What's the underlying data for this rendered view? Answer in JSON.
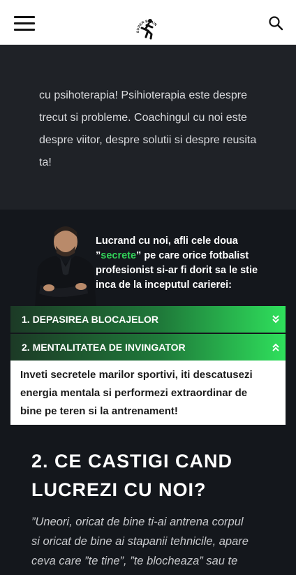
{
  "header": {
    "menu_icon": "hamburger-menu-icon",
    "logo_text": "SUPER BRAIN",
    "search_icon": "search-icon"
  },
  "intro": {
    "lines": [
      "cu psihoterapia! Psihioterapia este despre",
      "trecut si probleme. Coachingul cu noi este",
      "despre viitor, despre solutii si despre reusita",
      "ta!"
    ]
  },
  "secrets": {
    "line1": "Lucrand cu noi, afli cele doua",
    "line2_open": "”",
    "line2_accent": "secrete",
    "line2_rest": "” pe care orice fotbalist",
    "line3": "profesionist si-ar fi dorit sa le stie",
    "line4": "inca de la inceputul carierei:",
    "accent_color": "#31d158"
  },
  "accordion": {
    "items": [
      {
        "label": "1. DEPASIREA BLOCAJELOR",
        "icon": "chevron-double-down-icon",
        "expanded": false
      },
      {
        "label": "2. MENTALITATEA DE INVINGATOR",
        "icon": "chevron-double-up-icon",
        "expanded": true
      }
    ],
    "body_lines": [
      "Inveti secretele marilor sportivi, iti descatusezi",
      "energia mentala si performezi extraordinar de",
      "bine pe teren si la antrenament!"
    ]
  },
  "section2": {
    "heading_lines": [
      "2. CE CASTIGI CAND",
      "LUCREZI CU NOI?"
    ]
  },
  "quote": {
    "lines": [
      "”Uneori, oricat de bine ti-ai antrena corpul",
      "si oricat de bine ai stapanii tehnicile, apare",
      "ceva care ”te tine”, ”te blocheaza” sau te"
    ]
  }
}
